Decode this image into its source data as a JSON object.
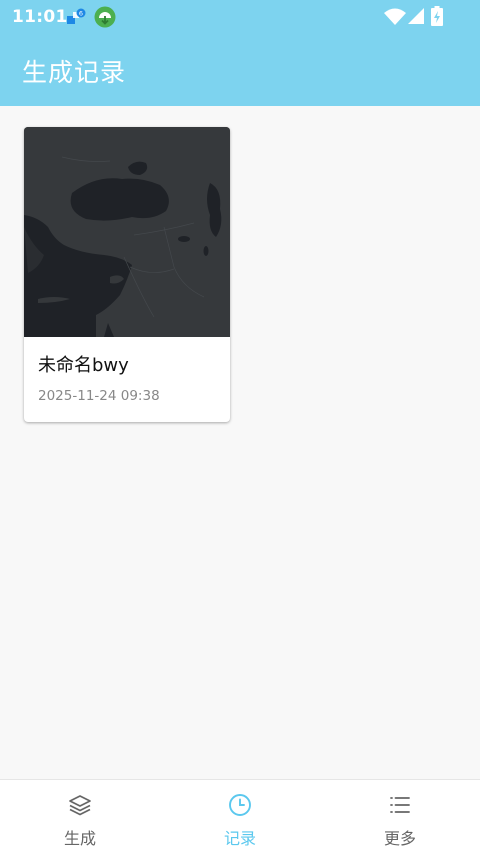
{
  "status_bar": {
    "time": "11:01",
    "icons": [
      "notification-badge-icon",
      "download-app-icon",
      "wifi-icon",
      "cell-signal-icon",
      "battery-charging-icon"
    ]
  },
  "app_bar": {
    "title": "生成记录",
    "background_color": "#7dd3ef"
  },
  "records": [
    {
      "title": "未命名bwy",
      "timestamp": "2025-11-24 09:38",
      "thumbnail": "dark-map-thumbnail"
    }
  ],
  "bottom_nav": {
    "items": [
      {
        "label": "生成",
        "icon": "layers-icon",
        "active": false
      },
      {
        "label": "记录",
        "icon": "clock-icon",
        "active": true
      },
      {
        "label": "更多",
        "icon": "list-menu-icon",
        "active": false
      }
    ],
    "active_color": "#5bc8ee",
    "inactive_color": "#666666"
  }
}
